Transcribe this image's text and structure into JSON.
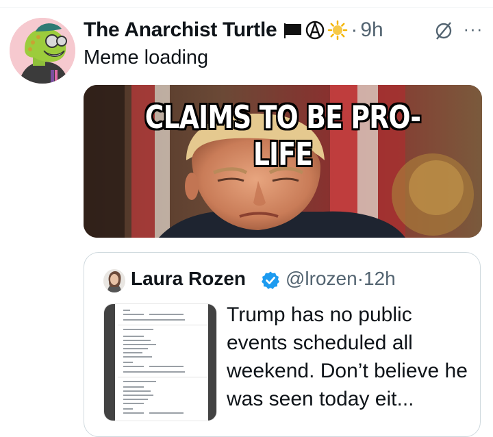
{
  "post": {
    "author_name": "The Anarchist Turtle",
    "author_emojis": [
      "black-flag-icon",
      "circle-a-icon",
      "sun-icon"
    ],
    "separator": "·",
    "time": "9h",
    "text": "Meme loading",
    "meme_caption": "CLAIMS TO BE PRO-LIFE",
    "more_label": "···"
  },
  "quote": {
    "author_name": "Laura Rozen",
    "handle": "@lrozen",
    "separator": "·",
    "time": "12h",
    "text": "Trump has no public events scheduled all weekend. Don’t believe he was seen today eit..."
  },
  "colors": {
    "text_primary": "#0f1419",
    "text_secondary": "#536471",
    "verified_blue": "#1d9bf0",
    "border": "#cfd9de",
    "avatar_bg": "#f6c9cf"
  }
}
